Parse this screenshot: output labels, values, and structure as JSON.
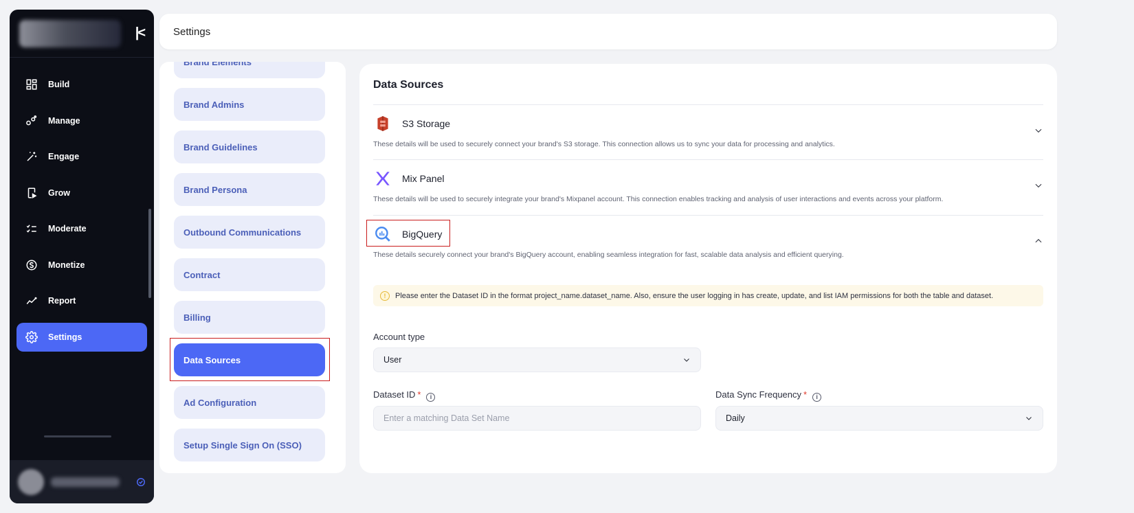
{
  "sidebar": {
    "collapse_icon": "collapse-left-icon",
    "items": [
      {
        "label": "Build",
        "icon": "grid-icon"
      },
      {
        "label": "Manage",
        "icon": "nodes-icon"
      },
      {
        "label": "Engage",
        "icon": "magic-wand-icon"
      },
      {
        "label": "Grow",
        "icon": "play-doc-icon"
      },
      {
        "label": "Moderate",
        "icon": "checklist-icon"
      },
      {
        "label": "Monetize",
        "icon": "dollar-circle-icon"
      },
      {
        "label": "Report",
        "icon": "trend-line-icon"
      },
      {
        "label": "Settings",
        "icon": "gear-icon",
        "active": true
      }
    ]
  },
  "header": {
    "title": "Settings"
  },
  "settings_menu": {
    "items": [
      {
        "label": "Brand Elements"
      },
      {
        "label": "Brand Admins"
      },
      {
        "label": "Brand Guidelines"
      },
      {
        "label": "Brand Persona"
      },
      {
        "label": "Outbound Communications"
      },
      {
        "label": "Contract"
      },
      {
        "label": "Billing"
      },
      {
        "label": "Data Sources",
        "active": true
      },
      {
        "label": "Ad Configuration"
      },
      {
        "label": "Setup Single Sign On (SSO)"
      }
    ]
  },
  "main": {
    "title": "Data Sources",
    "sources": [
      {
        "name": "S3 Storage",
        "icon": "aws-s3-icon",
        "description": "These details will be used to securely connect your brand's S3 storage. This connection allows us to sync your data for processing and analytics.",
        "expanded": false
      },
      {
        "name": "Mix Panel",
        "icon": "mixpanel-icon",
        "description": "These details will be used to securely integrate your brand's Mixpanel account. This connection enables tracking and analysis of user interactions and events across your platform.",
        "expanded": false
      },
      {
        "name": "BigQuery",
        "icon": "bigquery-icon",
        "description": "These details securely connect your brand's BigQuery account, enabling seamless integration for fast, scalable data analysis and efficient querying.",
        "expanded": true
      }
    ],
    "notice": "Please enter the Dataset ID in the format project_name.dataset_name. Also, ensure the user logging in has create, update, and list IAM permissions for both the table and dataset.",
    "form": {
      "account_type": {
        "label": "Account type",
        "value": "User"
      },
      "dataset_id": {
        "label": "Dataset ID",
        "required_mark": "*",
        "placeholder": "Enter a matching Data Set Name",
        "value": ""
      },
      "sync_frequency": {
        "label": "Data Sync Frequency",
        "required_mark": "*",
        "value": "Daily"
      }
    }
  },
  "colors": {
    "accent": "#4c68f5",
    "sidebar_bg": "#0c0e16",
    "menu_item_bg": "#eaedfa",
    "highlight_border": "#c91b1b",
    "notice_bg": "#fdf8e8"
  }
}
